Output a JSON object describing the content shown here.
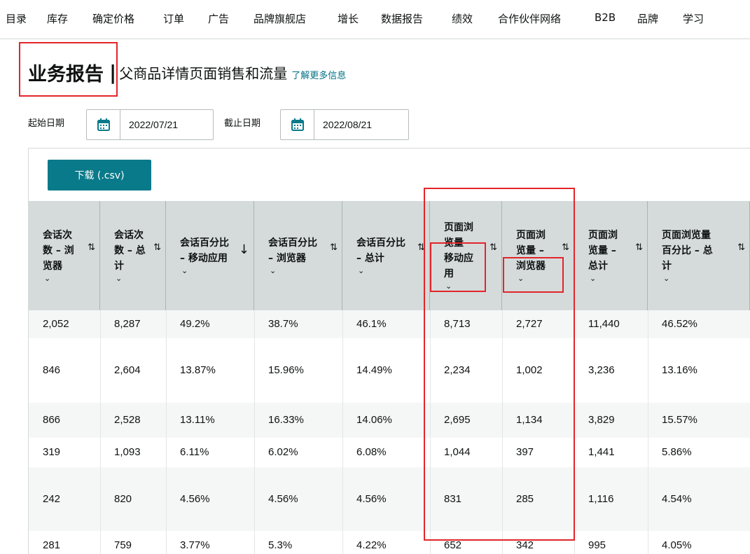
{
  "nav": [
    "目录",
    "库存",
    "确定价格",
    "订单",
    "广告",
    "品牌旗舰店",
    "增长",
    "数据报告",
    "绩效",
    "合作伙伴网络",
    "B2B",
    "品牌",
    "学习"
  ],
  "page": {
    "title": "业务报告",
    "separator": "|",
    "subtitle": "父商品详情页面销售和流量",
    "learn_more": "了解更多信息"
  },
  "dates": {
    "start_label": "起始日期",
    "start_value": "2022/07/21",
    "end_label": "截止日期",
    "end_value": "2022/08/21"
  },
  "download_label": "下载 (.csv)",
  "columns": [
    {
      "lines": [
        "会话次",
        "数 – 浏",
        "览器"
      ],
      "sort": "⇅"
    },
    {
      "lines": [
        "会话次",
        "数 – 总",
        "计"
      ],
      "sort": "⇅"
    },
    {
      "lines": [
        "会话百分比",
        "– 移动应用"
      ],
      "sort": "↓"
    },
    {
      "lines": [
        "会话百分比",
        "– 浏览器"
      ],
      "sort": "⇅"
    },
    {
      "lines": [
        "会话百分比",
        "– 总计"
      ],
      "sort": "⇅"
    },
    {
      "lines": [
        "页面浏",
        "览量 –",
        "移动应",
        "用"
      ],
      "sort": "⇅"
    },
    {
      "lines": [
        "页面浏",
        "览量 –",
        "浏览器"
      ],
      "sort": "⇅"
    },
    {
      "lines": [
        "页面浏",
        "览量 –",
        "总计"
      ],
      "sort": "⇅"
    },
    {
      "lines": [
        "页面浏览量",
        "百分比 – 总",
        "计"
      ],
      "sort": "⇅"
    }
  ],
  "rows": [
    [
      "2,052",
      "8,287",
      "49.2%",
      "38.7%",
      "46.1%",
      "8,713",
      "2,727",
      "11,440",
      "46.52%"
    ],
    [
      "846",
      "2,604",
      "13.87%",
      "15.96%",
      "14.49%",
      "2,234",
      "1,002",
      "3,236",
      "13.16%"
    ],
    [
      "866",
      "2,528",
      "13.11%",
      "16.33%",
      "14.06%",
      "2,695",
      "1,134",
      "3,829",
      "15.57%"
    ],
    [
      "319",
      "1,093",
      "6.11%",
      "6.02%",
      "6.08%",
      "1,044",
      "397",
      "1,441",
      "5.86%"
    ],
    [
      "242",
      "820",
      "4.56%",
      "4.56%",
      "4.56%",
      "831",
      "285",
      "1,116",
      "4.54%"
    ],
    [
      "281",
      "759",
      "3.77%",
      "5.3%",
      "4.22%",
      "652",
      "342",
      "995",
      "4.05%"
    ]
  ],
  "colors": {
    "accent": "#097a8a",
    "link": "#007185",
    "highlight": "#e3252a",
    "header_bg": "#d5dbdb"
  },
  "icons": {
    "calendar": "calendar-icon",
    "sort": "sort-icon",
    "chevron": "chevron-down-icon"
  }
}
